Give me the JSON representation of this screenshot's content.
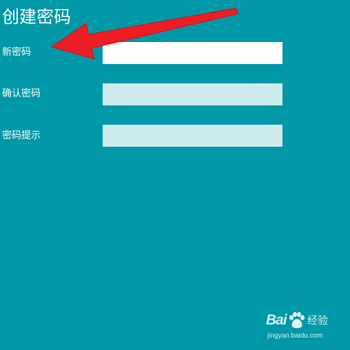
{
  "page": {
    "title": "创建密码",
    "background_color": "#0098a6"
  },
  "fields": [
    {
      "label": "新密码",
      "value": "",
      "state": "focused"
    },
    {
      "label": "确认密码",
      "value": "",
      "state": "inactive"
    },
    {
      "label": "密码提示",
      "value": "",
      "state": "inactive"
    }
  ],
  "annotation": {
    "icon": "red-arrow-icon",
    "color": "#ee1c25",
    "points_to": "新密码"
  },
  "watermark": {
    "brand": "Bai",
    "icon": "paw-icon",
    "product": "经验",
    "domain": "jingyan.baidu.com"
  }
}
